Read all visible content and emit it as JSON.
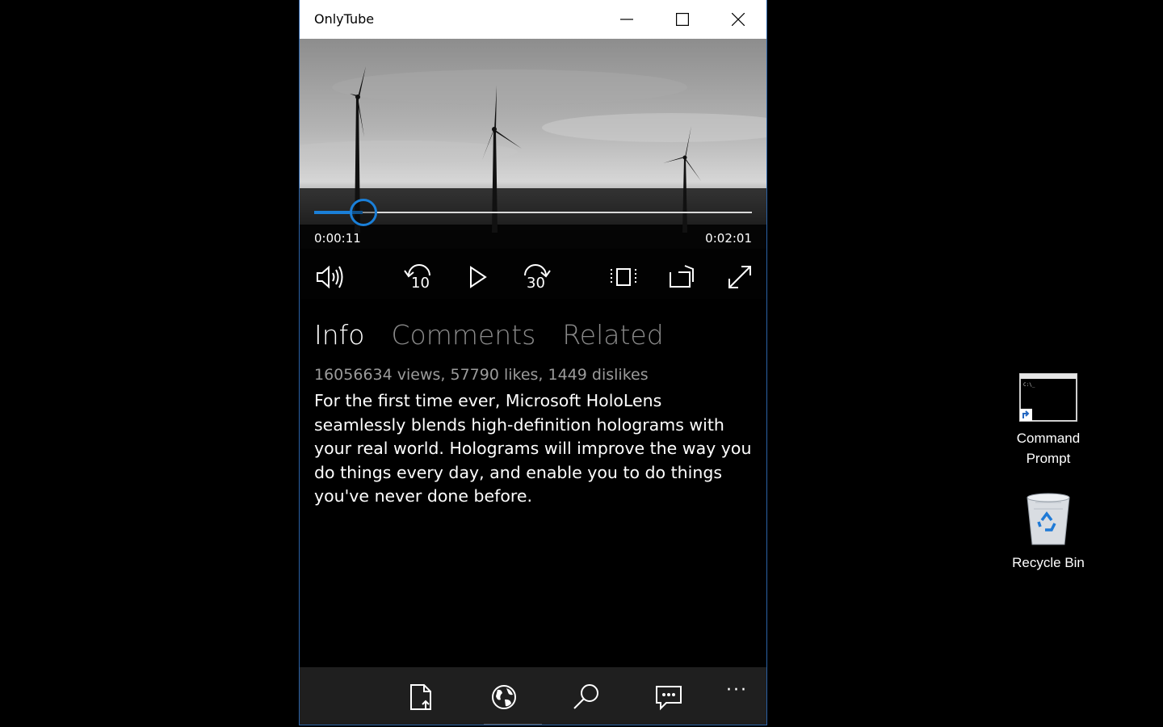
{
  "window": {
    "title": "OnlyTube",
    "controls": {
      "minimize": "minimize-icon",
      "maximize": "maximize-icon",
      "close": "close-icon"
    }
  },
  "player": {
    "current_time": "0:00:11",
    "duration": "0:02:01",
    "progress": 0.11,
    "controls": [
      "volume-icon",
      "rewind-10-icon",
      "play-icon",
      "forward-30-icon",
      "aspect-ratio-icon",
      "cast-icon",
      "fullscreen-icon"
    ],
    "rewind_label": "10",
    "forward_label": "30"
  },
  "tabs": [
    {
      "label": "Info",
      "active": true
    },
    {
      "label": "Comments",
      "active": false
    },
    {
      "label": "Related",
      "active": false
    }
  ],
  "info": {
    "stats": "16056634 views, 57790 likes, 1449 dislikes",
    "description": "For the first time ever, Microsoft HoloLens seamlessly blends high-definition holograms with your real world. Holograms will improve the way you do things every day, and enable you to do things you've never done before."
  },
  "appbar": {
    "buttons": [
      "share-file-icon",
      "globe-icon",
      "search-icon",
      "comments-icon",
      "more-icon"
    ],
    "more_label": "···"
  },
  "desktop": {
    "icons": [
      {
        "label_line1": "Command",
        "label_line2": "Prompt",
        "icon": "command-prompt-icon"
      },
      {
        "label": "Recycle Bin",
        "icon": "recycle-bin-icon"
      }
    ]
  },
  "colors": {
    "accent": "#1a7fd8",
    "window_border": "#2b63a8",
    "appbar": "#1f1f1f"
  }
}
